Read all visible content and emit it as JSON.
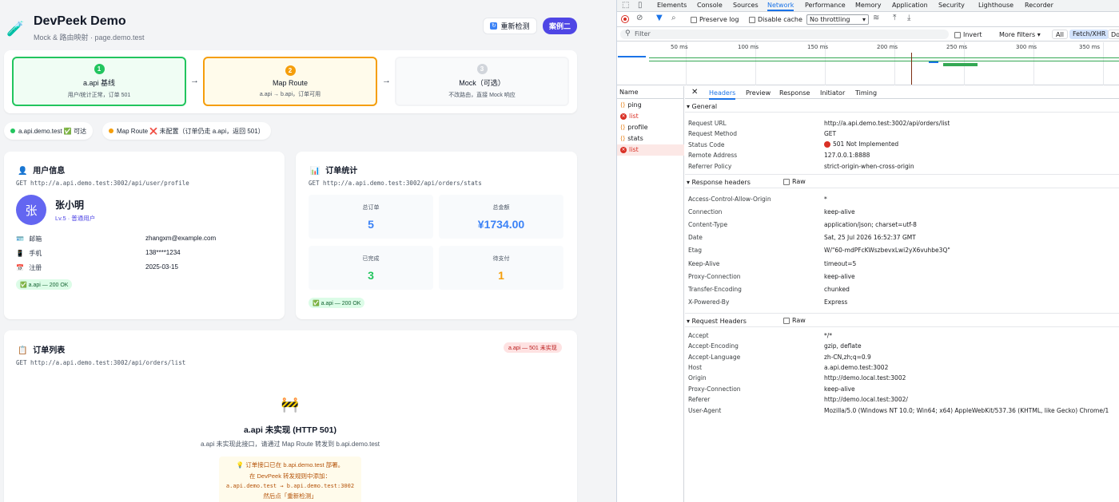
{
  "app": {
    "title": "DevPeek Demo",
    "subtitle": "Mock & 路由映射 · page.demo.test",
    "recheck_label": "重新检测",
    "case_label": "案例二",
    "steps": [
      {
        "num": "1",
        "title": "a.api 基线",
        "desc": "用户/统计正常，订单 501"
      },
      {
        "num": "2",
        "title": "Map Route",
        "desc": "a.api → b.api，订单可用"
      },
      {
        "num": "3",
        "title": "Mock（可选）",
        "desc": "不改路由，直接 Mock 响应"
      }
    ],
    "arrow": "→",
    "status_pills": [
      {
        "text": "a.api.demo.test ✅ 可达",
        "color": "#22c55e"
      },
      {
        "text": "Map Route ❌ 未配置（订单仍走 a.api，返回 501）",
        "color": "#f59e0b"
      }
    ],
    "user": {
      "icon": "👤",
      "title": "用户信息",
      "endpoint": "GET http://a.api.demo.test:3002/api/user/profile",
      "avatar": "张",
      "name": "张小明",
      "level": "Lv.5 · 普通用户",
      "rows": [
        {
          "icon": "🪪",
          "label": "邮箱",
          "value": "zhangxm@example.com"
        },
        {
          "icon": "📱",
          "label": "手机",
          "value": "138****1234"
        },
        {
          "icon": "📅",
          "label": "注册",
          "value": "2025-03-15"
        }
      ],
      "badge": "✅ a.api — 200 OK"
    },
    "stats": {
      "icon": "📊",
      "title": "订单统计",
      "endpoint": "GET http://a.api.demo.test:3002/api/orders/stats",
      "items": [
        {
          "label": "总订单",
          "value": "5",
          "color": "#3b82f6"
        },
        {
          "label": "总金额",
          "value": "¥1734.00",
          "color": "#3b82f6"
        },
        {
          "label": "已完成",
          "value": "3",
          "color": "#22c55e"
        },
        {
          "label": "待支付",
          "value": "1",
          "color": "#f59e0b"
        }
      ],
      "badge": "✅ a.api — 200 OK"
    },
    "orders": {
      "icon": "📋",
      "title": "订单列表",
      "endpoint": "GET http://a.api.demo.test:3002/api/orders/list",
      "error_badge": "a.api — 501 未实现",
      "err_icon": "🚧",
      "err_title": "a.api 未实现 (HTTP 501)",
      "err_desc": "a.api 未实现此接口，请通过 Map Route 转发到 b.api.demo.test",
      "tip1": "💡 订单接口已在 b.api.demo.test 部署。",
      "tip2": "在 DevPeek 转发规则中添加：",
      "tip3": "a.api.demo.test → b.api.demo.test:3002",
      "tip4": "然后点「重新检测」"
    }
  },
  "devtools": {
    "tabs": [
      "Elements",
      "Console",
      "Sources",
      "Network",
      "Performance",
      "Memory",
      "Application",
      "Security",
      "Lighthouse",
      "Recorder"
    ],
    "active_tab": "Network",
    "preserve_log": "Preserve log",
    "disable_cache": "Disable cache",
    "throttling": "No throttling",
    "filter_placeholder": "Filter",
    "invert": "Invert",
    "more_filters": "More filters ▾",
    "filter_all": "All",
    "filter_fetch": "Fetch/XHR",
    "filter_doc": "Do",
    "ticks": [
      "50 ms",
      "100 ms",
      "150 ms",
      "200 ms",
      "250 ms",
      "300 ms",
      "350 ms"
    ],
    "name_header": "Name",
    "requests": [
      {
        "name": "ping",
        "type": "ok"
      },
      {
        "name": "list",
        "type": "error"
      },
      {
        "name": "profile",
        "type": "ok"
      },
      {
        "name": "stats",
        "type": "ok"
      },
      {
        "name": "list",
        "type": "error-selected"
      }
    ],
    "detail_tabs": [
      "Headers",
      "Preview",
      "Response",
      "Initiator",
      "Timing"
    ],
    "general_title": "▾ General",
    "general": [
      {
        "k": "Request URL",
        "v": "http://a.api.demo.test:3002/api/orders/list"
      },
      {
        "k": "Request Method",
        "v": "GET"
      },
      {
        "k": "Status Code",
        "v": "501 Not Implemented"
      },
      {
        "k": "Remote Address",
        "v": "127.0.0.1:8888"
      },
      {
        "k": "Referrer Policy",
        "v": "strict-origin-when-cross-origin"
      }
    ],
    "resp_title": "▾ Response headers",
    "raw": "Raw",
    "response_headers": [
      {
        "k": "Access-Control-Allow-Origin",
        "v": "*"
      },
      {
        "k": "Connection",
        "v": "keep-alive"
      },
      {
        "k": "Content-Type",
        "v": "application/json; charset=utf-8"
      },
      {
        "k": "Date",
        "v": "Sat, 25 Jul 2026 16:52:37 GMT"
      },
      {
        "k": "Etag",
        "v": "W/\"60-mdPFcKWszbevxLwi2yX6vuhbe3Q\""
      },
      {
        "k": "Keep-Alive",
        "v": "timeout=5"
      },
      {
        "k": "Proxy-Connection",
        "v": "keep-alive"
      },
      {
        "k": "Transfer-Encoding",
        "v": "chunked"
      },
      {
        "k": "X-Powered-By",
        "v": "Express"
      }
    ],
    "req_title": "▾ Request Headers",
    "request_headers": [
      {
        "k": "Accept",
        "v": "*/*"
      },
      {
        "k": "Accept-Encoding",
        "v": "gzip, deflate"
      },
      {
        "k": "Accept-Language",
        "v": "zh-CN,zh;q=0.9"
      },
      {
        "k": "Host",
        "v": "a.api.demo.test:3002"
      },
      {
        "k": "Origin",
        "v": "http://demo.local.test:3002"
      },
      {
        "k": "Proxy-Connection",
        "v": "keep-alive"
      },
      {
        "k": "Referer",
        "v": "http://demo.local.test:3002/"
      },
      {
        "k": "User-Agent",
        "v": "Mozilla/5.0 (Windows NT 10.0; Win64; x64) AppleWebKit/537.36 (KHTML, like Gecko) Chrome/1"
      }
    ]
  }
}
